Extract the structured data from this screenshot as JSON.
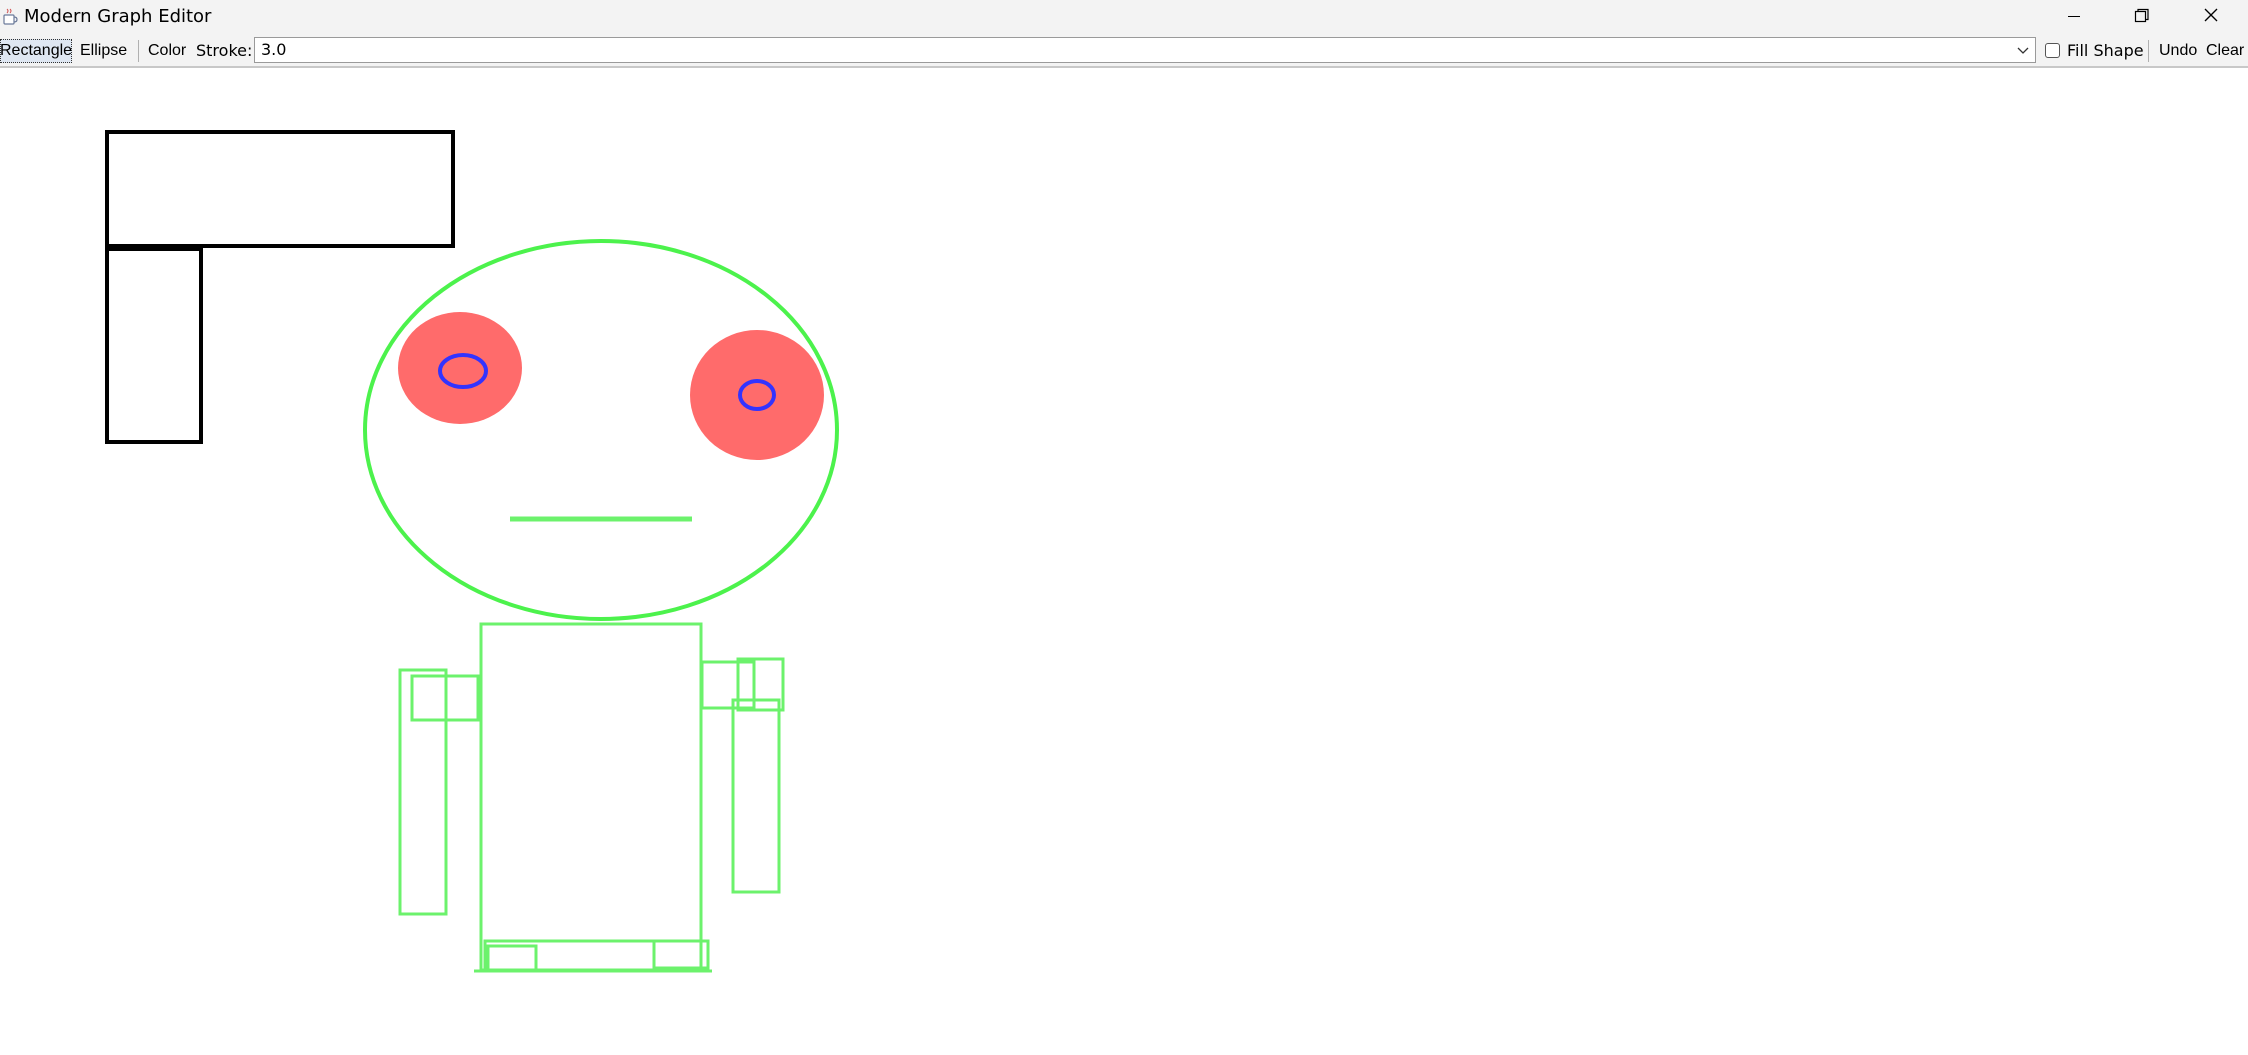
{
  "window": {
    "title": "Modern Graph Editor",
    "icons": {
      "app": "java-coffee-icon",
      "minimize": "minimize-icon",
      "restore": "restore-icon",
      "close": "close-icon"
    }
  },
  "toolbar": {
    "rectangle_label": "Rectangle",
    "ellipse_label": "Ellipse",
    "color_label": "Color",
    "stroke_label": "Stroke:",
    "stroke_value": "3.0",
    "fill_shape_label": "Fill Shape",
    "fill_shape_checked": false,
    "undo_label": "Undo",
    "clear_label": "Clear",
    "selected_tool": "Rectangle"
  },
  "canvas": {
    "colors": {
      "black": "#000000",
      "green": "#4cf24c",
      "red": "#ff6b6b",
      "blue": "#3333ff"
    }
  }
}
